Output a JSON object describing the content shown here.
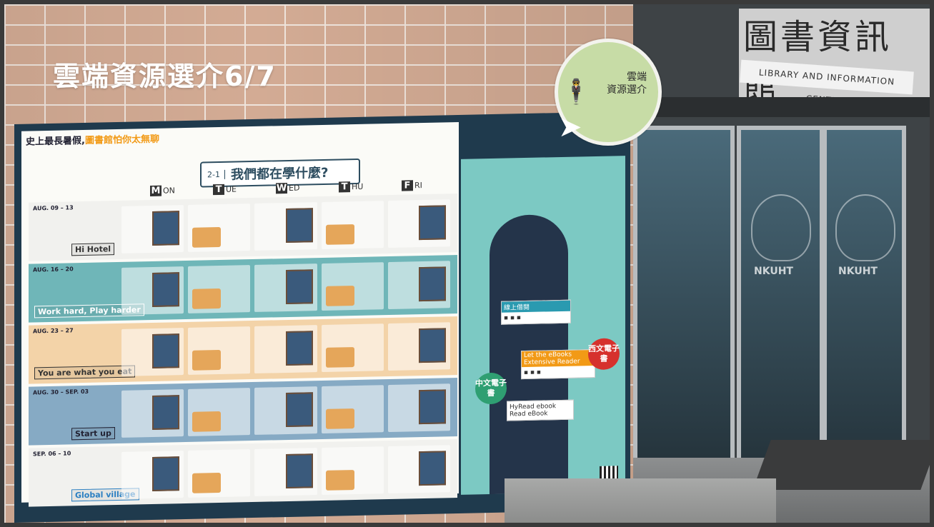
{
  "title": "雲端資源選介6/7",
  "badge": {
    "line1": "雲端",
    "line2": "資源選介"
  },
  "library_sign": {
    "zh": "圖書資訊館",
    "en": "LIBRARY AND INFORMATION CENTER"
  },
  "poster": {
    "slogan_prefix": "史上最長暑假,",
    "slogan_accent": "圖書館怕你太無聊",
    "banner_tag": "2-1",
    "banner_text": "我們都在學什麼?",
    "days": [
      {
        "letter": "M",
        "rest": "ON"
      },
      {
        "letter": "T",
        "rest": "UE"
      },
      {
        "letter": "W",
        "rest": "ED"
      },
      {
        "letter": "T",
        "rest": "HU"
      },
      {
        "letter": "F",
        "rest": "RI"
      }
    ],
    "weeks": [
      {
        "date": "AUG. 09 – 13",
        "theme": "Hi Hotel",
        "color": "#f1f1ee"
      },
      {
        "date": "AUG. 16 – 20",
        "theme": "Work hard, Play harder",
        "color": "#6fb6b8"
      },
      {
        "date": "AUG. 23 – 27",
        "theme": "You are what you eat",
        "color": "#f3d3a8"
      },
      {
        "date": "AUG. 30 – SEP. 03",
        "theme": "Start up",
        "color": "#86aac4"
      },
      {
        "date": "SEP. 06 – 10",
        "theme": "Global village",
        "color": "#f1f1ee"
      }
    ],
    "right_panel": {
      "pin_chinese": "中文電子書",
      "pin_western": "西文電子書",
      "card_lending": "線上借閱",
      "card_extensive": "Let the eBooks Extensive Reader",
      "card_hyread": "HyRead ebook",
      "card_readebook": "Read eBook"
    }
  },
  "etched_logo_text": "NKUHT",
  "colors": {
    "wall": "#d3ab94",
    "poster_frame": "#1f3a4d",
    "badge": "#c7dca6",
    "pin_red": "#d6312d",
    "pin_green": "#2f9f72"
  }
}
